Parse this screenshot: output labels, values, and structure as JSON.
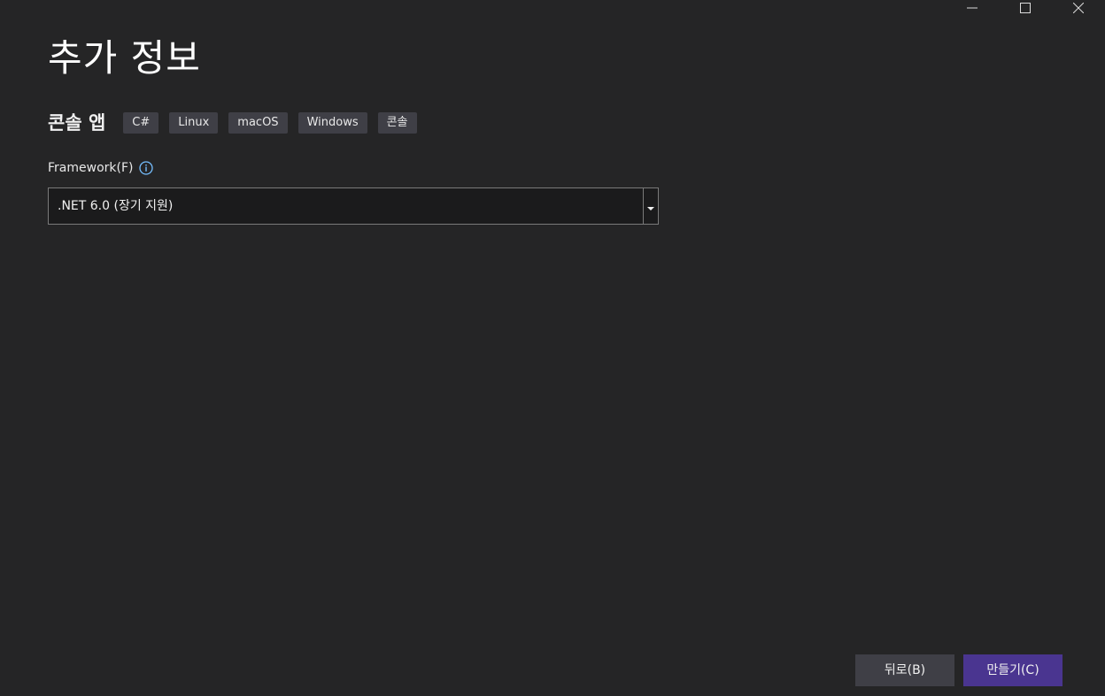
{
  "header": {
    "title": "추가 정보"
  },
  "template": {
    "name": "콘솔 앱",
    "tags": [
      "C#",
      "Linux",
      "macOS",
      "Windows",
      "콘솔"
    ]
  },
  "framework": {
    "label": "Framework(F)",
    "value": ".NET 6.0 (장기 지원)"
  },
  "footer": {
    "back_label": "뒤로(B)",
    "create_label": "만들기(C)"
  },
  "icons": {
    "minimize": "minimize-icon",
    "maximize": "maximize-icon",
    "close": "close-icon",
    "info": "info-icon",
    "dropdown": "chevron-down-icon"
  },
  "colors": {
    "background": "#252526",
    "tag_background": "#3f3f46",
    "primary_button": "#4a3590",
    "info_icon": "#75beff"
  }
}
